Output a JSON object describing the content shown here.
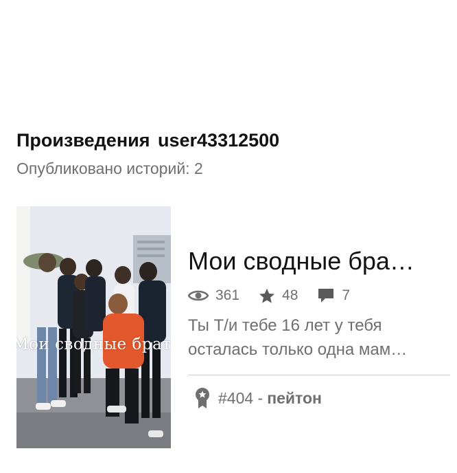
{
  "header": {
    "works_label": "Произведения",
    "username": "user43312500",
    "published_count_text": "Опубликовано историй: 2"
  },
  "story": {
    "cover": {
      "overlay_text": "Мои сводные братья"
    },
    "title": "Мои сводные бра…",
    "stats": {
      "views": "361",
      "votes": "48",
      "comments": "7"
    },
    "description_lines": [
      "Ты Т/и тебе 16 лет у тебя",
      "осталась только одна мам…"
    ],
    "rank": {
      "number": "#404 - ",
      "tag": "пейтон"
    }
  },
  "icons": {
    "views": "eye-icon",
    "votes": "star-icon",
    "comments": "comment-icon",
    "rank": "ribbon-badge-icon"
  },
  "colors": {
    "text_dark": "#121212",
    "text_muted": "#6f6f6f",
    "divider": "#cfcfcf"
  }
}
